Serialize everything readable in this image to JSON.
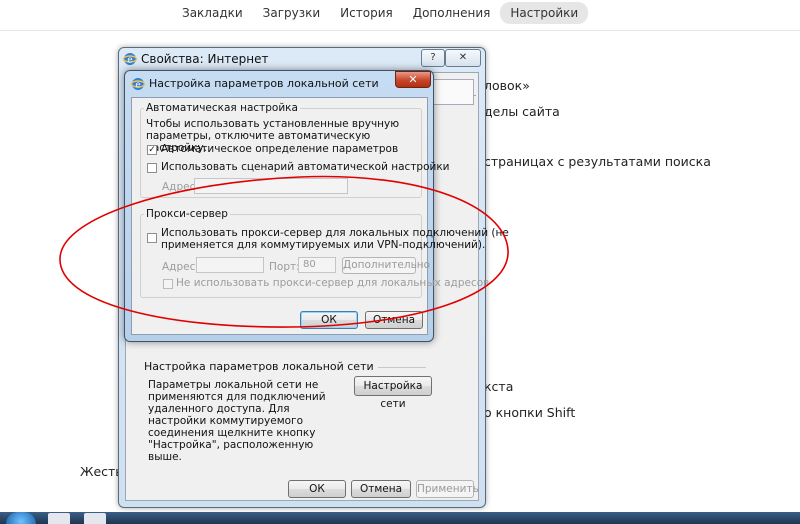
{
  "browser": {
    "nav": [
      "Закладки",
      "Загрузки",
      "История",
      "Дополнения",
      "Настройки"
    ],
    "active_nav": "Настройки",
    "bg_lines": [
      "ловок»",
      "делы сайта",
      "страницах с результатами поиска",
      "кста",
      "о кнопки Shift",
      "Жесты"
    ]
  },
  "outer_dialog": {
    "title": "Свойства: Интернет",
    "help_button": "?",
    "close_button": "✕",
    "lan_section_label": "Настройка параметров локальной сети",
    "lan_description": "Параметры локальной сети не применяются для подключений удаленного доступа. Для настройки коммутируемого соединения щелкните кнопку \"Настройка\", расположенную выше.",
    "lan_settings_button": "Настройка сети",
    "ok_button": "ОК",
    "cancel_button": "Отмена",
    "apply_button": "Применить"
  },
  "lan_dialog": {
    "title": "Настройка параметров локальной сети",
    "close_button": "✕",
    "auto_group_label": "Автоматическая настройка",
    "auto_description": "Чтобы использовать установленные вручную параметры, отключите автоматическую настройку.",
    "auto_detect": {
      "label": "Автоматическое определение параметров",
      "checked": true
    },
    "use_script": {
      "label": "Использовать сценарий автоматической настройки",
      "checked": false
    },
    "script_address_label": "Адрес",
    "script_address_value": "",
    "proxy_group_label": "Прокси-сервер",
    "use_proxy": {
      "label_line1": "Использовать прокси-сервер для локальных подключений (не",
      "label_line2": "применяется для коммутируемых или VPN-подключений).",
      "checked": false
    },
    "proxy_address_label": "Адрес:",
    "proxy_address_value": "",
    "proxy_port_label": "Порт:",
    "proxy_port_value": "80",
    "advanced_button": "Дополнительно",
    "bypass_local": {
      "label": "Не использовать прокси-сервер для локальных адресов",
      "checked": false
    },
    "ok_button": "ОК",
    "cancel_button": "Отмена"
  },
  "annotation": {
    "shape": "ellipse",
    "color": "#e00000"
  },
  "colors": {
    "title_glass": "#c6dcf2",
    "close_red": "#c7452b",
    "link": "#2a6db5"
  }
}
